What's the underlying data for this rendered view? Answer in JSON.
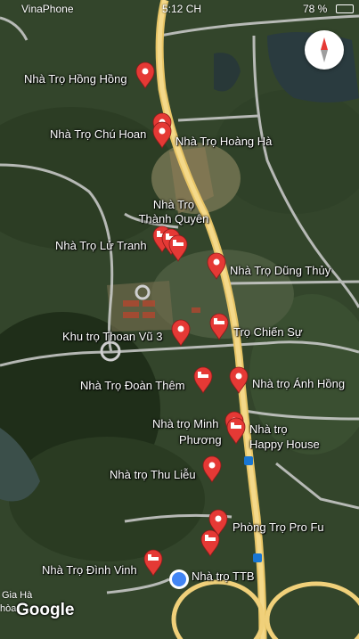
{
  "status_bar": {
    "carrier": "VinaPhone",
    "time": "5:12 CH",
    "battery": "78 %"
  },
  "compass": {
    "icon": "compass-icon"
  },
  "labels": {
    "hong_hong": "Nhà Trọ Hồng Hồng",
    "chu_hoan": "Nhà Trọ Chú Hoan",
    "hoang_ha": "Nhà Trọ Hoàng Hà",
    "thanh_quyen_1": "Nhà Trọ",
    "thanh_quyen_2": "Thành Quyên",
    "lu_tranh": "Nhà Trọ Lử Tranh",
    "dung_thuy": "Nhà Trọ Dũng Thủy",
    "thoan_vu": "Khu trọ Thoan Vũ 3",
    "chien_su": "Trọ Chiến Sự",
    "doan_them": "Nhà Trọ Đoàn Thêm",
    "anh_hong": "Nhà trọ Ánh Hồng",
    "minh_phuong_1": "Nhà trọ Minh",
    "minh_phuong_2": "Phương",
    "happy_house_1": "Nhà trọ",
    "happy_house_2": "Happy House",
    "thu_lieu": "Nhà trọ Thu Liễu",
    "pro_fu": "Phòng Trọ Pro Fu",
    "dinh_vinh": "Nhà Trọ Đình Vinh",
    "ttb": "Nhà trọ TTB",
    "gia_ha": "Gia Hà",
    "hoa": "hòa"
  },
  "brand": "Google",
  "colors": {
    "pin": "#e53935",
    "road_main": "#f3d27a",
    "road_minor": "#d6d6d6",
    "location": "#4285f4"
  }
}
